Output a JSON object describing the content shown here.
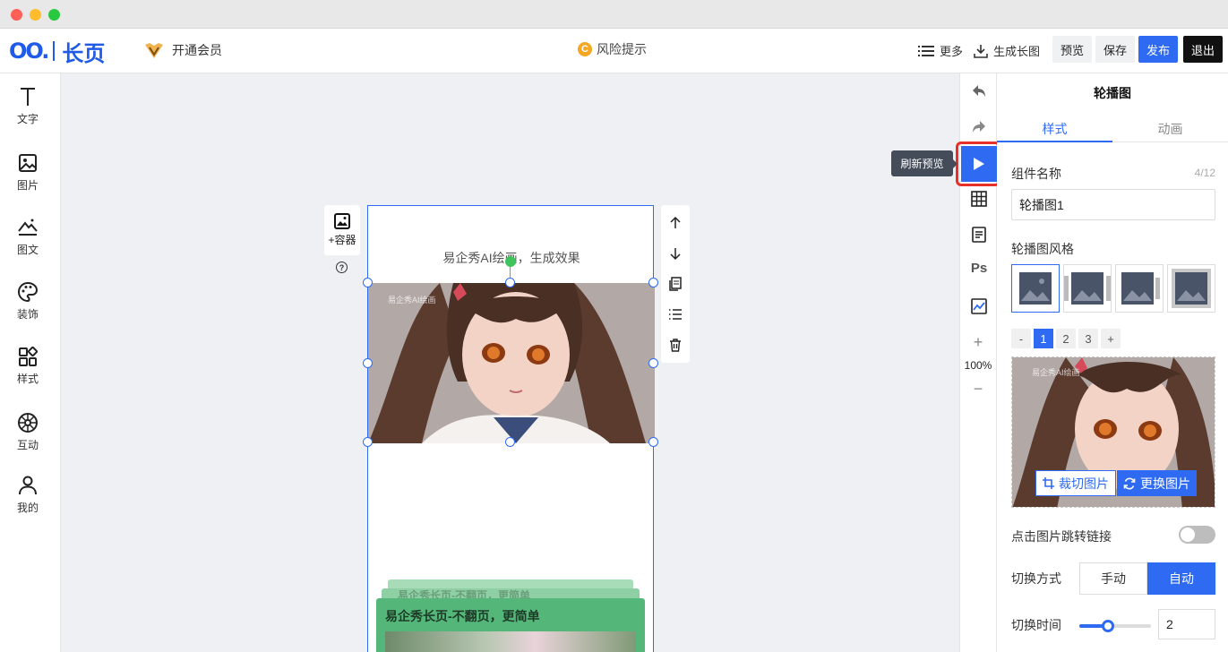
{
  "header": {
    "logo_mark": "OO.",
    "logo_text": "长页",
    "vip_label": "开通会员",
    "risk_icon_glyph": "C",
    "risk_label": "风险提示",
    "more_label": "更多",
    "longimage_label": "生成长图",
    "preview_label": "预览",
    "save_label": "保存",
    "publish_label": "发布",
    "exit_label": "退出"
  },
  "left_tools": [
    {
      "label": "文字",
      "icon": "text-icon"
    },
    {
      "label": "图片",
      "icon": "image-icon"
    },
    {
      "label": "图文",
      "icon": "image-text-icon"
    },
    {
      "label": "装饰",
      "icon": "palette-icon"
    },
    {
      "label": "样式",
      "icon": "style-grid-icon"
    },
    {
      "label": "互动",
      "icon": "interact-wheel-icon"
    },
    {
      "label": "我的",
      "icon": "user-icon"
    }
  ],
  "canvas": {
    "container_label": "+容器",
    "help_glyph": "?",
    "page_title": "易企秀AI绘画，生成效果",
    "image_watermark": "易企秀AI绘画",
    "card_back_title": "易企秀长页-不翻页，更简单",
    "card_title": "易企秀长页-不翻页，更简单"
  },
  "toolstrip": {
    "tooltip": "刷新预览",
    "ps_label": "Ps",
    "zoom_plus": "+",
    "zoom_value": "100%",
    "zoom_minus": "−"
  },
  "panel": {
    "title": "轮播图",
    "tabs": [
      "样式",
      "动画"
    ],
    "name_label": "组件名称",
    "name_count": "4/12",
    "name_value": "轮播图1",
    "style_label": "轮播图风格",
    "pager": [
      "-",
      "1",
      "2",
      "3",
      "+"
    ],
    "preview_watermark": "易企秀AI绘画",
    "crop_label": "裁切图片",
    "replace_label": "更换图片",
    "link_label": "点击图片跳转链接",
    "link_enabled": false,
    "switch_label": "切换方式",
    "switch_manual": "手动",
    "switch_auto": "自动",
    "time_label": "切换时间",
    "time_value": "2",
    "time_slider_fraction": 0.4
  },
  "colors": {
    "accent": "#2f6bf2",
    "highlight_border": "#e8302a",
    "card_green": "#55b67a"
  }
}
